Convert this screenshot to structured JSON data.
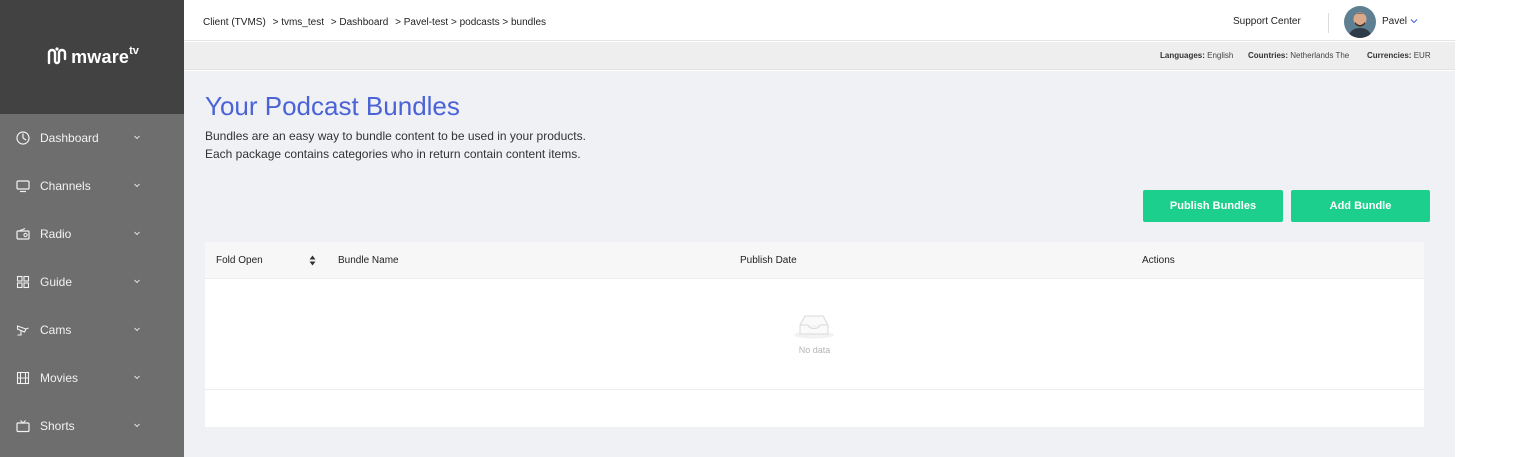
{
  "brand": {
    "name": "mware",
    "suffix": "tv"
  },
  "sidebar": {
    "items": [
      {
        "label": "Dashboard",
        "icon": "dashboard-icon"
      },
      {
        "label": "Channels",
        "icon": "monitor-icon"
      },
      {
        "label": "Radio",
        "icon": "radio-icon"
      },
      {
        "label": "Guide",
        "icon": "grid-icon"
      },
      {
        "label": "Cams",
        "icon": "camera-icon"
      },
      {
        "label": "Movies",
        "icon": "film-icon"
      },
      {
        "label": "Shorts",
        "icon": "tv-icon"
      }
    ]
  },
  "breadcrumb": {
    "client": "Client (TVMS)",
    "tenant": "> tvms_test",
    "dashboard": "> Dashboard",
    "path": "> Pavel-test > podcasts > bundles"
  },
  "header": {
    "support": "Support Center",
    "user": "Pavel"
  },
  "locale": {
    "languages_label": "Languages:",
    "languages_value": "English",
    "countries_label": "Countries:",
    "countries_value": "Netherlands The",
    "currencies_label": "Currencies:",
    "currencies_value": "EUR"
  },
  "page": {
    "title": "Your Podcast Bundles",
    "desc_line1": "Bundles are an easy way to bundle content to be used in your products.",
    "desc_line2": "Each package contains categories who in return contain content items.",
    "publish_button": "Publish Bundles",
    "add_button": "Add Bundle"
  },
  "table": {
    "columns": [
      "Fold Open",
      "Bundle Name",
      "Publish Date",
      "Actions"
    ],
    "rows": [],
    "empty_text": "No data"
  },
  "colors": {
    "accent": "#4a63d6",
    "button": "#1ccf8c",
    "sidebar": "#6e6e6e",
    "sidebar_header": "#424242",
    "main_bg": "#f0f1f5"
  }
}
